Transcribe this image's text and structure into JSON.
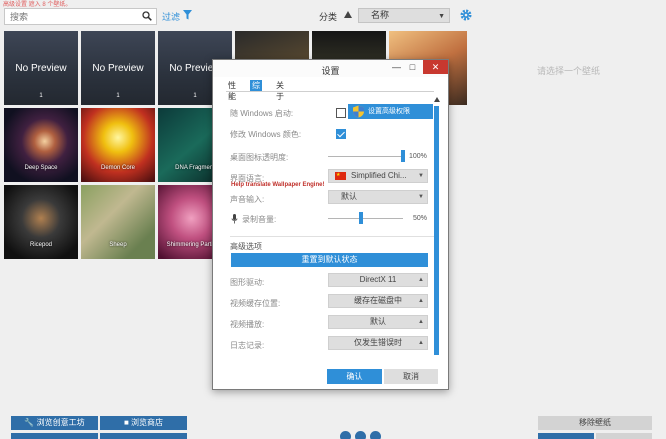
{
  "top_warning": "高级设置 遮入 8 个壁纸。",
  "toolbar": {
    "search_placeholder": "搜索",
    "filter_label": "过滤",
    "sort_label": "分类",
    "sort_value": "名称"
  },
  "right_panel_hint": "请选择一个壁纸",
  "grid": {
    "no_preview_label": "No Preview",
    "tiles": [
      {
        "caption": "1"
      },
      {
        "caption": "1"
      },
      {
        "caption": "1"
      },
      {
        "caption": "Deep Space"
      },
      {
        "caption": "Demon Core"
      },
      {
        "caption": "DNA Fragment"
      },
      {
        "caption": "Ricepod"
      },
      {
        "caption": "Sheep"
      },
      {
        "caption": "Shimmering Particles"
      }
    ]
  },
  "settings_dialog": {
    "title": "设置",
    "minimize": "—",
    "maximize": "□",
    "close": "✕",
    "tabs": [
      {
        "label": "性能"
      },
      {
        "label": "综合"
      },
      {
        "label": "关于"
      }
    ],
    "active_tab": 1,
    "rows": {
      "windows_startup_label": "随 Windows 启动:",
      "admin_button_label": "设置高级权限",
      "windows_colors_label": "修改 Windows 颜色:",
      "desktop_opacity_label": "桌面图标透明度:",
      "desktop_opacity_value": "100%",
      "desktop_opacity": 1.0,
      "ui_language_label": "界面语言:",
      "ui_language_value": "Simplified Chi...",
      "help_translate_link": "Help translate Wallpaper Engine!",
      "audio_input_label": "声音输入:",
      "audio_input_value": "默认",
      "recording_volume_label": "录制音量:",
      "recording_volume_value": "50%",
      "recording_volume": 0.5,
      "advanced_heading": "高级选项",
      "reset_button_label": "重置到默认状态",
      "graphics_driver_label": "图形驱动:",
      "graphics_driver_value": "DirectX 11",
      "video_cache_label": "视频缓存位置:",
      "video_cache_value": "缓存在磁盘中",
      "video_loop_label": "视频播放:",
      "video_loop_value": "默认",
      "log_label": "日志记录:",
      "log_value": "仅发生错误时"
    },
    "windows_startup_checked": false,
    "windows_colors_checked": true,
    "ok_label": "确认",
    "cancel_label": "取消"
  },
  "bottom": {
    "workshop_button": "浏览创意工坊",
    "store_button": "浏览商店",
    "remove_all_button": "移除壁纸"
  }
}
